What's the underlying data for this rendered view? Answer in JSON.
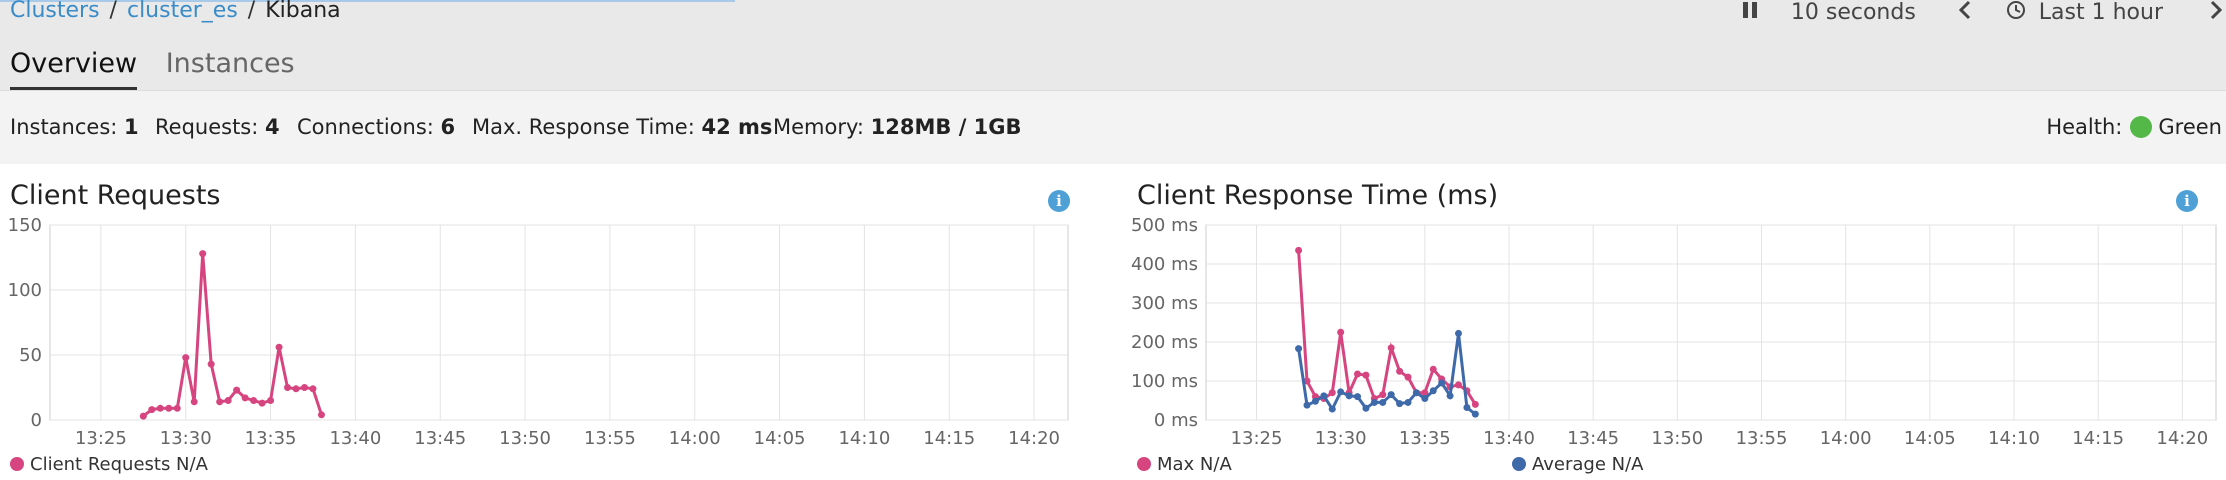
{
  "breadcrumb": {
    "items": [
      "Clusters",
      "cluster_es"
    ],
    "current": "Kibana",
    "separator": "/"
  },
  "tabs": [
    {
      "label": "Overview",
      "active": true
    },
    {
      "label": "Instances",
      "active": false
    }
  ],
  "controls": {
    "pause_icon": "pause-icon",
    "interval": "10 seconds",
    "prev_icon": "chevron-left-icon",
    "clock_icon": "clock-icon",
    "range": "Last 1 hour",
    "next_icon": "chevron-right-icon"
  },
  "stats": {
    "instances_label": "Instances:",
    "instances_value": "1",
    "requests_label": "Requests:",
    "requests_value": "4",
    "connections_label": "Connections:",
    "connections_value": "6",
    "max_response_label": "Max. Response Time:",
    "max_response_value": "42 ms",
    "memory_label": "Memory:",
    "memory_value": "128MB / 1GB",
    "health_label": "Health:",
    "health_value": "Green",
    "health_color": "#54b848"
  },
  "colors": {
    "pink": "#d6457f",
    "blue": "#3e6aaa",
    "grid": "#e3e3e3",
    "info": "#4ea0d6"
  },
  "chart_data": [
    {
      "type": "line",
      "title": "Client Requests",
      "x_ticks": [
        "13:25",
        "13:30",
        "13:35",
        "13:40",
        "13:45",
        "13:50",
        "13:55",
        "14:00",
        "14:05",
        "14:10",
        "14:15",
        "14:20"
      ],
      "xlim": [
        "13:22",
        "14:22"
      ],
      "ylim": [
        0,
        150
      ],
      "y_ticks": [
        0,
        50,
        100,
        150
      ],
      "y_tick_labels": [
        "0",
        "50",
        "100",
        "150"
      ],
      "grid": true,
      "series": [
        {
          "name": "Client Requests N/A",
          "color": "#d6457f",
          "x": [
            "13:27:30",
            "13:28:00",
            "13:28:30",
            "13:29:00",
            "13:29:30",
            "13:30:00",
            "13:30:30",
            "13:31:00",
            "13:31:30",
            "13:32:00",
            "13:32:30",
            "13:33:00",
            "13:33:30",
            "13:34:00",
            "13:34:30",
            "13:35:00",
            "13:35:30",
            "13:36:00",
            "13:36:30",
            "13:37:00",
            "13:37:30",
            "13:38:00"
          ],
          "values": [
            3,
            8,
            9,
            9,
            9,
            48,
            14,
            128,
            43,
            14,
            15,
            23,
            17,
            15,
            13,
            15,
            56,
            25,
            24,
            25,
            24,
            4
          ]
        }
      ]
    },
    {
      "type": "line",
      "title": "Client Response Time (ms)",
      "x_ticks": [
        "13:25",
        "13:30",
        "13:35",
        "13:40",
        "13:45",
        "13:50",
        "13:55",
        "14:00",
        "14:05",
        "14:10",
        "14:15",
        "14:20"
      ],
      "xlim": [
        "13:22",
        "14:22"
      ],
      "ylim": [
        0,
        500
      ],
      "y_ticks": [
        0,
        100,
        200,
        300,
        400,
        500
      ],
      "y_tick_labels": [
        "0 ms",
        "100 ms",
        "200 ms",
        "300 ms",
        "400 ms",
        "500 ms"
      ],
      "grid": true,
      "series": [
        {
          "name": "Max N/A",
          "color": "#d6457f",
          "x": [
            "13:27:30",
            "13:28:00",
            "13:28:30",
            "13:29:00",
            "13:29:30",
            "13:30:00",
            "13:30:30",
            "13:31:00",
            "13:31:30",
            "13:32:00",
            "13:32:30",
            "13:33:00",
            "13:33:30",
            "13:34:00",
            "13:34:30",
            "13:35:00",
            "13:35:30",
            "13:36:00",
            "13:36:30",
            "13:37:00",
            "13:37:30",
            "13:38:00"
          ],
          "values": [
            435,
            100,
            60,
            55,
            70,
            225,
            70,
            118,
            115,
            55,
            65,
            185,
            125,
            110,
            70,
            70,
            130,
            105,
            85,
            90,
            75,
            40
          ]
        },
        {
          "name": "Average N/A",
          "color": "#3e6aaa",
          "x": [
            "13:27:30",
            "13:28:00",
            "13:28:30",
            "13:29:00",
            "13:29:30",
            "13:30:00",
            "13:30:30",
            "13:31:00",
            "13:31:30",
            "13:32:00",
            "13:32:30",
            "13:33:00",
            "13:33:30",
            "13:34:00",
            "13:34:30",
            "13:35:00",
            "13:35:30",
            "13:36:00",
            "13:36:30",
            "13:37:00",
            "13:37:30",
            "13:38:00"
          ],
          "values": [
            183,
            38,
            48,
            62,
            28,
            72,
            62,
            60,
            30,
            45,
            45,
            65,
            42,
            45,
            70,
            55,
            75,
            95,
            62,
            222,
            32,
            15
          ]
        }
      ]
    }
  ]
}
